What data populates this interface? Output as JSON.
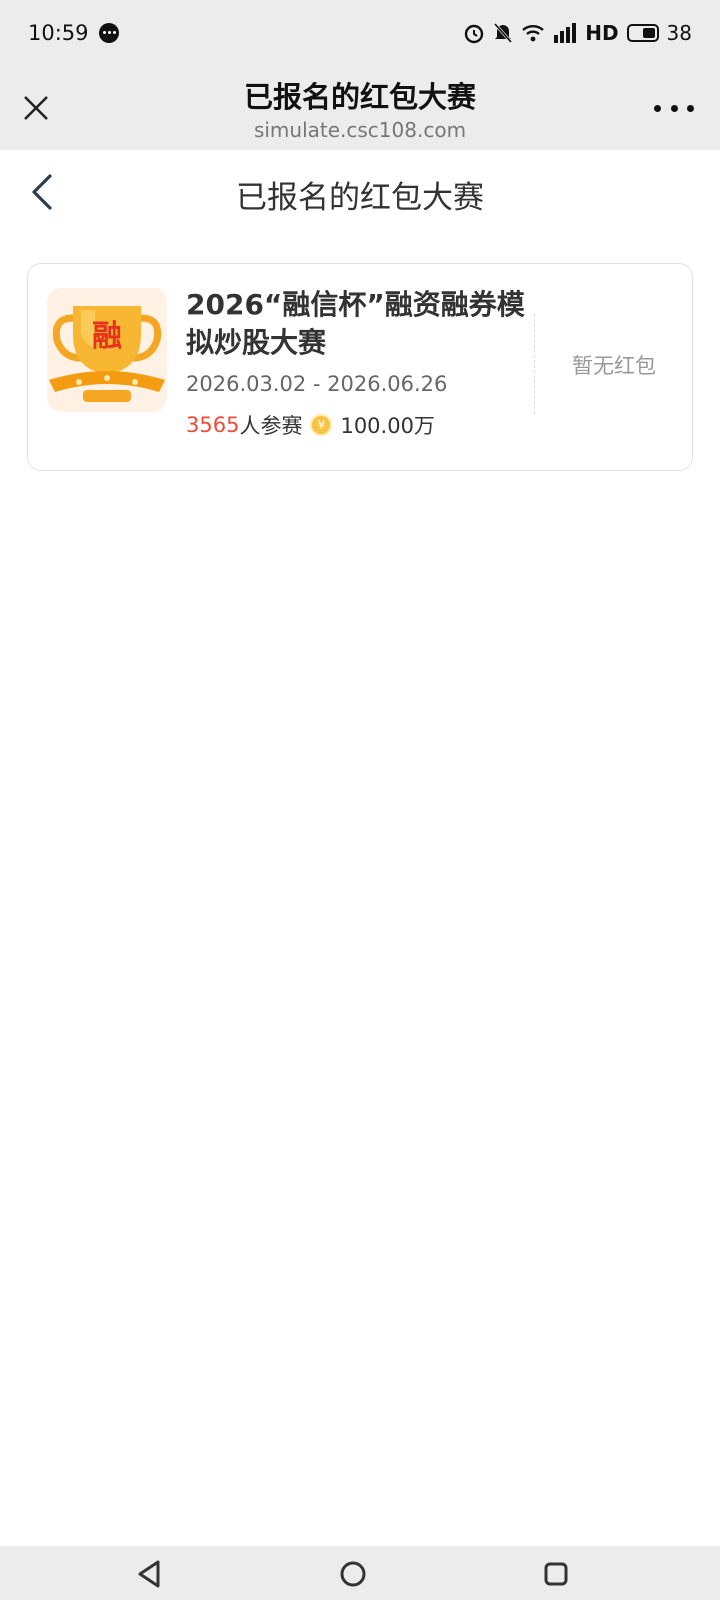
{
  "status_bar": {
    "time": "10:59",
    "network": "HD",
    "battery": "38",
    "icons": [
      "message-icon",
      "alarm-icon",
      "mute-icon",
      "wifi-icon",
      "signal-icon",
      "battery-icon"
    ]
  },
  "web_header": {
    "title": "已报名的红包大赛",
    "url": "simulate.csc108.com"
  },
  "page": {
    "title": "已报名的红包大赛"
  },
  "contest": {
    "badge_char": "融",
    "title": "2026“融信杯”融资融券模拟炒股大赛",
    "date_range": "2026.03.02 - 2026.06.26",
    "participants": "3565",
    "participants_suffix": "人参赛",
    "coin_symbol": "¥",
    "prize": "100.00万",
    "redpacket_status": "暂无红包"
  },
  "colors": {
    "accent_red": "#f04a3a",
    "header_bg": "#ececec",
    "coin": "#f6c343"
  }
}
